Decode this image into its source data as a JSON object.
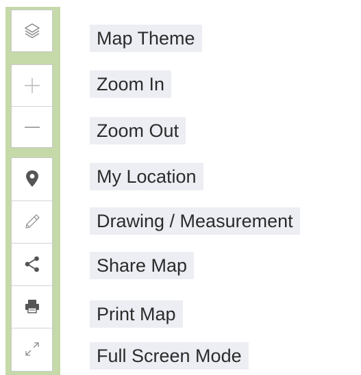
{
  "toolbar": {
    "buttons": [
      {
        "icon": "layers-icon",
        "label": "Map Theme"
      },
      {
        "icon": "plus-icon",
        "label": "Zoom In"
      },
      {
        "icon": "minus-icon",
        "label": "Zoom Out"
      },
      {
        "icon": "location-pin-icon",
        "label": "My Location"
      },
      {
        "icon": "pencil-icon",
        "label": "Drawing / Measurement"
      },
      {
        "icon": "share-icon",
        "label": "Share Map"
      },
      {
        "icon": "printer-icon",
        "label": "Print Map"
      },
      {
        "icon": "expand-icon",
        "label": "Full Screen Mode"
      }
    ]
  },
  "colors": {
    "rail_green": "#c5d9a9",
    "label_background": "#eceef3",
    "icon_gray": "#9a9a9a",
    "icon_dark": "#555555"
  }
}
